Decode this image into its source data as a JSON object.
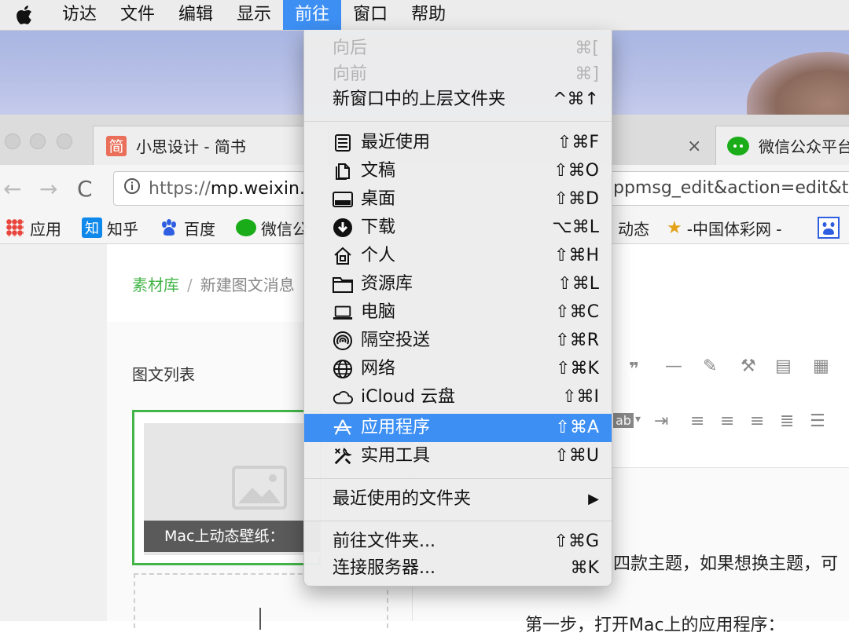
{
  "menubar": {
    "apple_icon": "apple-logo-icon",
    "items": [
      "访达",
      "文件",
      "编辑",
      "显示",
      "前往",
      "窗口",
      "帮助"
    ],
    "active_index": 4
  },
  "browser": {
    "tabs": [
      {
        "favicon_text": "简",
        "title": "小思设计 - 简书"
      },
      {
        "title": "微信公众平台"
      }
    ],
    "close_glyph": "×",
    "url_scheme": "https://",
    "url_host": "mp.weixin.",
    "url_tail": "ppmsg_edit&action=edit&t",
    "bookmarks": {
      "apps": "应用",
      "zhihu_icon_text": "知",
      "zhihu": "知乎",
      "baidu": "百度",
      "weixin": "微信公",
      "dongtai": "动态",
      "lottery": "-中国体彩网 -"
    }
  },
  "page": {
    "breadcrumb_root": "素材库",
    "breadcrumb_sep": "/",
    "breadcrumb_current": "新建图文消息",
    "list_title": "图文列表",
    "card_caption": "Mac上动态壁纸：",
    "body_text": "四款主题，如果想换主题，可",
    "body_text2": "第一步，打开Mac上的应用程序："
  },
  "go_menu": {
    "rows": [
      {
        "label": "向后",
        "shortcut": "⌘[",
        "disabled": true
      },
      {
        "label": "向前",
        "shortcut": "⌘]",
        "disabled": true
      },
      {
        "label": "新窗口中的上层文件夹",
        "shortcut": "^⌘↑"
      },
      {
        "label": "最近使用",
        "shortcut": "⇧⌘F",
        "icon": "recents-icon"
      },
      {
        "label": "文稿",
        "shortcut": "⇧⌘O",
        "icon": "documents-icon"
      },
      {
        "label": "桌面",
        "shortcut": "⇧⌘D",
        "icon": "desktop-icon"
      },
      {
        "label": "下载",
        "shortcut": "⌥⌘L",
        "icon": "downloads-icon"
      },
      {
        "label": "个人",
        "shortcut": "⇧⌘H",
        "icon": "home-icon"
      },
      {
        "label": "资源库",
        "shortcut": "⇧⌘L",
        "icon": "library-folder-icon"
      },
      {
        "label": "电脑",
        "shortcut": "⇧⌘C",
        "icon": "computer-icon"
      },
      {
        "label": "隔空投送",
        "shortcut": "⇧⌘R",
        "icon": "airdrop-icon"
      },
      {
        "label": "网络",
        "shortcut": "⇧⌘K",
        "icon": "network-icon"
      },
      {
        "label": "iCloud 云盘",
        "shortcut": "⇧⌘I",
        "icon": "icloud-icon"
      },
      {
        "label": "应用程序",
        "shortcut": "⇧⌘A",
        "icon": "applications-icon",
        "highlighted": true
      },
      {
        "label": "实用工具",
        "shortcut": "⇧⌘U",
        "icon": "utilities-icon"
      },
      {
        "label": "最近使用的文件夹",
        "shortcut": "▶"
      },
      {
        "label": "前往文件夹...",
        "shortcut": "⇧⌘G"
      },
      {
        "label": "连接服务器...",
        "shortcut": "⌘K"
      }
    ]
  },
  "colors": {
    "menu_highlight": "#3d8ff4",
    "accent_green": "#44b549",
    "jianshu_red": "#ea6f5a",
    "wechat_green": "#1aad19"
  }
}
